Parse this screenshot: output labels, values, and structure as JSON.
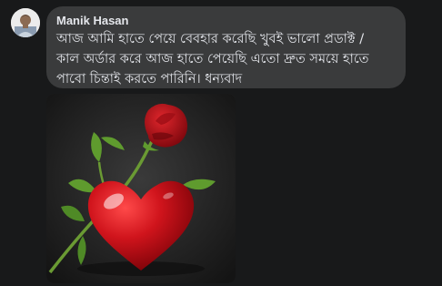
{
  "comment": {
    "author": "Manik Hasan",
    "lines": [
      "আজ আমি হাতে পেয়ে বেবহার করেছি খুবই ভালো প্রডাক্ট /",
      "কাল অর্ডার করে আজ হাতে পেয়েছি এতো দ্রুত সময়ে হাতে",
      "পাবো চিন্তাই করতে পারিনি। ধন্যবাদ"
    ],
    "avatar_icon": "user-avatar",
    "attachment": {
      "subject": "red-heart-with-rose-image",
      "watermark": "",
      "colors": {
        "heart": "#c8111b",
        "rose": "#b3121a",
        "leaf": "#5f9b2e",
        "background": "#222222"
      }
    }
  },
  "colors": {
    "page_background": "#18191a",
    "bubble_background": "#3a3b3c",
    "text": "#e4e6eb"
  }
}
